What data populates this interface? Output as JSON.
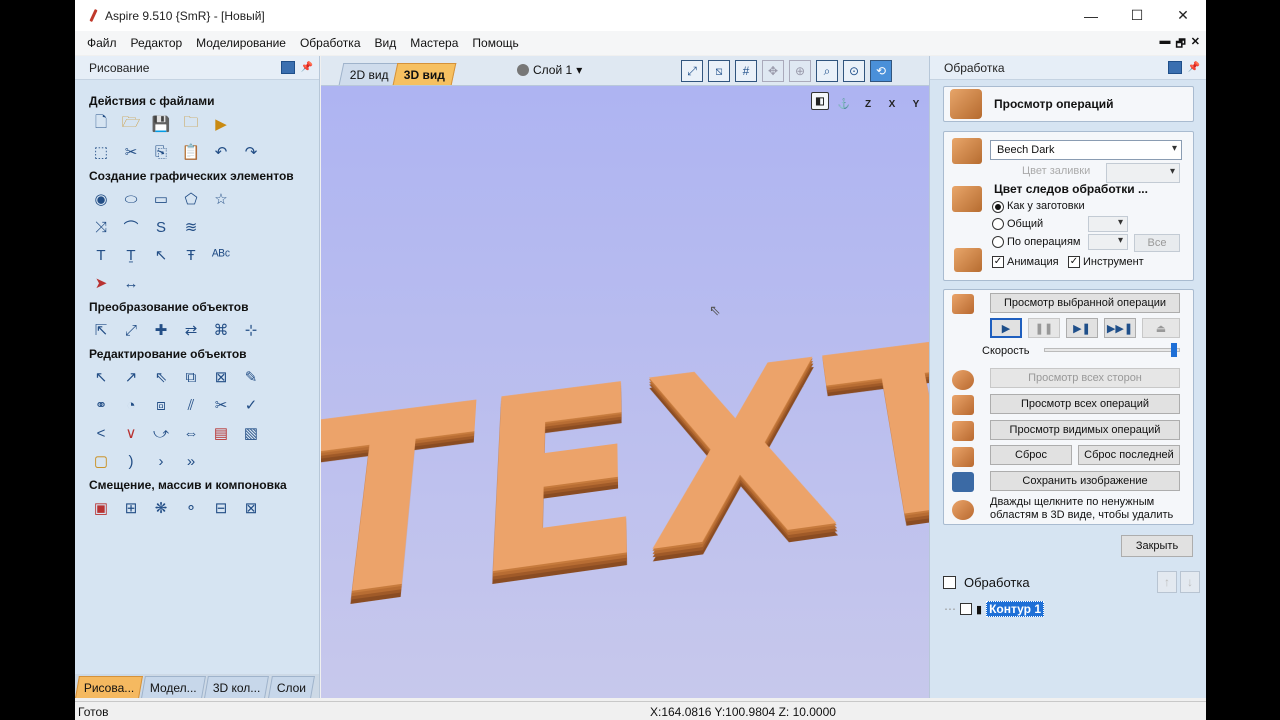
{
  "window": {
    "title": "Aspire 9.510 {SmR} - [Новый]",
    "controls": {
      "minimize": "—",
      "maximize": "☐",
      "close": "✕"
    },
    "mdi_controls": {
      "minimize": "▬",
      "restore": "🗗",
      "close": "✕"
    }
  },
  "menu": [
    "Файл",
    "Редактор",
    "Моделирование",
    "Обработка",
    "Вид",
    "Мастера",
    "Помощь"
  ],
  "left_panel": {
    "title": "Рисование",
    "sections": {
      "file_actions": "Действия с файлами",
      "create_vectors": "Создание графических элементов",
      "transform": "Преобразование объектов",
      "edit": "Редактирование объектов",
      "offset": "Смещение, массив и компоновка"
    },
    "tabs": [
      "Рисова...",
      "Модел...",
      "3D кол...",
      "Слои"
    ]
  },
  "view": {
    "tab_2d": "2D вид",
    "tab_3d": "3D вид",
    "layer": "Слой 1",
    "model_text": "TEXT",
    "axis_labels": [
      "Z",
      "X",
      "Y"
    ]
  },
  "right_panel": {
    "title": "Обработка",
    "header": "Просмотр операций",
    "material": "Beech Dark",
    "fill_color_label": "Цвет заливки",
    "toolpath_color_label": "Цвет следов обработки ...",
    "radio_as_material": "Как у заготовки",
    "radio_common": "Общий",
    "radio_per_operation": "По операциям",
    "all_button": "Все",
    "animation_label": "Анимация",
    "tool_label": "Инструмент",
    "preview_selected": "Просмотр выбранной операции",
    "speed_label": "Скорость",
    "speed_value": 0.98,
    "preview_all_sides": "Просмотр всех сторон",
    "preview_all_ops": "Просмотр всех операций",
    "preview_visible_ops": "Просмотр видимых операций",
    "reset": "Сброс",
    "reset_last": "Сброс последней",
    "save_image": "Сохранить изображение",
    "hint": "Дважды щелкните по ненужным областям в 3D виде, чтобы удалить",
    "close": "Закрыть",
    "tree_title": "Обработка",
    "tree_item": "Контур 1"
  },
  "status": {
    "left": "Готов",
    "coords": "X:164.0816 Y:100.9804 Z: 10.0000"
  }
}
